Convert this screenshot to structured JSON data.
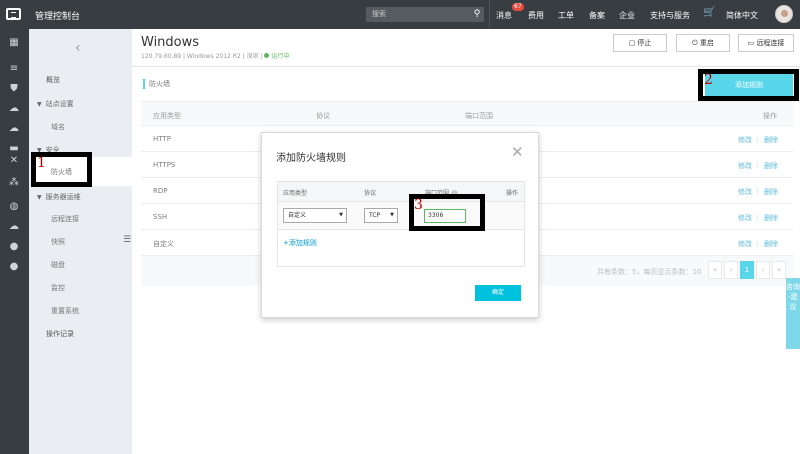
{
  "topbar": {
    "title": "管理控制台",
    "search_placeholder": "搜索",
    "nav": [
      "消息",
      "费用",
      "工单",
      "备案",
      "企业",
      "支持与服务"
    ],
    "message_count": "67",
    "language": "简体中文"
  },
  "sidebar": {
    "items": [
      {
        "label": "概览",
        "type": "item"
      },
      {
        "label": "站点设置",
        "type": "group"
      },
      {
        "label": "域名",
        "type": "sub"
      },
      {
        "label": "安全",
        "type": "group"
      },
      {
        "label": "防火墙",
        "type": "active"
      },
      {
        "label": "服务器运维",
        "type": "group"
      },
      {
        "label": "远程连接",
        "type": "sub"
      },
      {
        "label": "快照",
        "type": "sub"
      },
      {
        "label": "磁盘",
        "type": "sub"
      },
      {
        "label": "监控",
        "type": "sub"
      },
      {
        "label": "重置系统",
        "type": "sub"
      },
      {
        "label": "操作记录",
        "type": "item"
      }
    ]
  },
  "header": {
    "title": "Windows",
    "info": "120.79.60.89 | Windows 2012 R2 | 深圳 |",
    "status": "运行中",
    "buttons": [
      "停止",
      "重启",
      "远程连接"
    ]
  },
  "firewall": {
    "section_title": "防火墙",
    "add_button": "添加规则",
    "columns": [
      "应用类型",
      "协议",
      "端口范围",
      "操作"
    ],
    "rows": [
      "HTTP",
      "HTTPS",
      "RDP",
      "SSH",
      "自定义"
    ],
    "op_edit": "修改",
    "op_delete": "删除",
    "pager_text": "共有条数：5，每页显示条数：10",
    "pager": [
      "«",
      "‹",
      "1",
      "›",
      "»"
    ]
  },
  "dialog": {
    "title": "添加防火墙规则",
    "columns": [
      "应用类型",
      "协议",
      "端口范围",
      "操作"
    ],
    "app_type": "自定义",
    "protocol": "TCP",
    "port": "3306",
    "add_rule_link": "+添加规则",
    "confirm": "确定"
  },
  "annotations": [
    "1",
    "2",
    "3"
  ],
  "feedback": "咨询·建议",
  "colors": {
    "accent": "#00c1de",
    "dark": "#373d41",
    "link": "#0099cc",
    "marker": "#c00000"
  }
}
